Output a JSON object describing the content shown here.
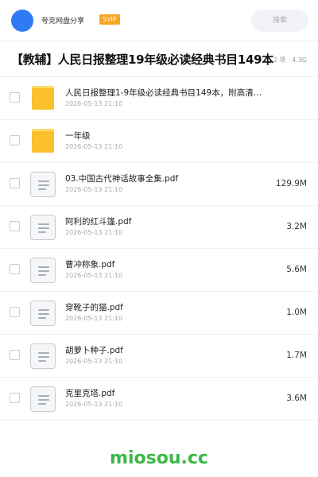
{
  "header": {
    "site_name": "夸克网盘分享",
    "badge": "SVIP",
    "search_placeholder": "搜索"
  },
  "folder": {
    "title": "【教辅】人民日报整理19年级必读经典书目149本",
    "meta": "2 项 · 4.3G"
  },
  "files": [
    {
      "type": "folder",
      "name": "人民日报整理1-9年级必读经典书目149本，附高清…",
      "date": "2026-05-13 21:10",
      "size": ""
    },
    {
      "type": "folder",
      "name": "一年级",
      "date": "2026-05-13 21:10",
      "size": ""
    },
    {
      "type": "pdf",
      "name": "03.中国古代神话故事全集.pdf",
      "date": "2026-05-13 21:10",
      "size": "129.9M"
    },
    {
      "type": "pdf",
      "name": "阿利的红斗篷.pdf",
      "date": "2026-05-13 21:10",
      "size": "3.2M"
    },
    {
      "type": "pdf",
      "name": "曹冲称象.pdf",
      "date": "2026-05-13 21:10",
      "size": "5.6M"
    },
    {
      "type": "pdf",
      "name": "穿靴子的猫.pdf",
      "date": "2026-05-13 21:10",
      "size": "1.0M"
    },
    {
      "type": "pdf",
      "name": "胡萝卜种子.pdf",
      "date": "2026-05-13 21:10",
      "size": "1.7M"
    },
    {
      "type": "pdf",
      "name": "克里克塔.pdf",
      "date": "2026-05-13 21:10",
      "size": "3.6M"
    }
  ],
  "watermark": "miosou.cc",
  "colors": {
    "accent": "#2f7bf5",
    "svip": "#f5a623",
    "folder": "#fbc02d",
    "watermark": "#3cb846"
  }
}
